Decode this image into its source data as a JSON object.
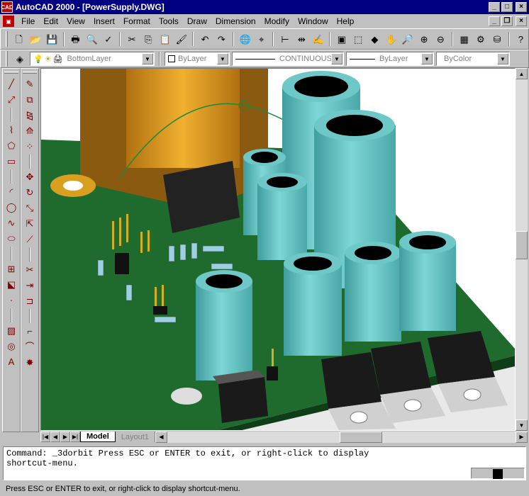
{
  "window": {
    "title": "AutoCAD 2000 - [PowerSupply.DWG]",
    "app_icon_text": "CAD",
    "minimize": "_",
    "maximize": "□",
    "close": "×"
  },
  "menu": {
    "items": [
      "File",
      "Edit",
      "View",
      "Insert",
      "Format",
      "Tools",
      "Draw",
      "Dimension",
      "Modify",
      "Window",
      "Help"
    ],
    "doc_minimize": "_",
    "doc_restore": "❐",
    "doc_close": "×"
  },
  "standard_toolbar": {
    "icons": [
      {
        "name": "new-icon",
        "glyph": "🗋"
      },
      {
        "name": "open-icon",
        "glyph": "📂"
      },
      {
        "name": "save-icon",
        "glyph": "💾"
      },
      {
        "name": "print-icon",
        "glyph": "🖶"
      },
      {
        "name": "print-preview-icon",
        "glyph": "🔍"
      },
      {
        "name": "spelling-icon",
        "glyph": "✓"
      },
      {
        "name": "cut-icon",
        "glyph": "✂"
      },
      {
        "name": "copy-icon",
        "glyph": "⎘"
      },
      {
        "name": "paste-icon",
        "glyph": "📋"
      },
      {
        "name": "match-properties-icon",
        "glyph": "🖌"
      },
      {
        "name": "undo-icon",
        "glyph": "↶"
      },
      {
        "name": "redo-icon",
        "glyph": "↷"
      },
      {
        "name": "hyperlink-icon",
        "glyph": "🌐"
      },
      {
        "name": "object-snap-icon",
        "glyph": "⌖"
      },
      {
        "name": "ucs-icon",
        "glyph": "⊢"
      },
      {
        "name": "inquiry-icon",
        "glyph": "⇹"
      },
      {
        "name": "redraw-icon",
        "glyph": "✍"
      },
      {
        "name": "named-views-icon",
        "glyph": "▣"
      },
      {
        "name": "3d-views-icon",
        "glyph": "⬚"
      },
      {
        "name": "shade-icon",
        "glyph": "◆"
      },
      {
        "name": "pan-icon",
        "glyph": "✋"
      },
      {
        "name": "zoom-realtime-icon",
        "glyph": "🔎"
      },
      {
        "name": "zoom-window-icon",
        "glyph": "⊕"
      },
      {
        "name": "zoom-previous-icon",
        "glyph": "⊖"
      },
      {
        "name": "properties-icon",
        "glyph": "▦"
      },
      {
        "name": "design-center-icon",
        "glyph": "⚙"
      },
      {
        "name": "dbconnect-icon",
        "glyph": "⛁"
      },
      {
        "name": "help-icon",
        "glyph": "?"
      }
    ]
  },
  "properties_toolbar": {
    "layer_icons": [
      "◈",
      "💡",
      "☀",
      "🖨"
    ],
    "layer": "BottomLayer",
    "color": "ByLayer",
    "linetype": "CONTINUOUS",
    "lineweight": "ByLayer",
    "plotstyle": "ByColor"
  },
  "draw_toolbar": {
    "icons": [
      {
        "name": "line-icon",
        "glyph": "╱"
      },
      {
        "name": "construction-line-icon",
        "glyph": "⤢"
      },
      {
        "name": "polyline-icon",
        "glyph": "⌇"
      },
      {
        "name": "polygon-icon",
        "glyph": "⬠"
      },
      {
        "name": "rectangle-icon",
        "glyph": "▭"
      },
      {
        "name": "arc-icon",
        "glyph": "◜"
      },
      {
        "name": "circle-icon",
        "glyph": "◯"
      },
      {
        "name": "spline-icon",
        "glyph": "∿"
      },
      {
        "name": "ellipse-icon",
        "glyph": "⬭"
      },
      {
        "name": "insert-block-icon",
        "glyph": "⊞"
      },
      {
        "name": "make-block-icon",
        "glyph": "⬕"
      },
      {
        "name": "point-icon",
        "glyph": "·"
      },
      {
        "name": "hatch-icon",
        "glyph": "▨"
      },
      {
        "name": "region-icon",
        "glyph": "◎"
      },
      {
        "name": "multiline-text-icon",
        "glyph": "A"
      }
    ]
  },
  "modify_toolbar": {
    "icons": [
      {
        "name": "erase-icon",
        "glyph": "✎"
      },
      {
        "name": "copy-object-icon",
        "glyph": "⧉"
      },
      {
        "name": "mirror-icon",
        "glyph": "⧎"
      },
      {
        "name": "offset-icon",
        "glyph": "⟰"
      },
      {
        "name": "array-icon",
        "glyph": "⁘"
      },
      {
        "name": "move-icon",
        "glyph": "✥"
      },
      {
        "name": "rotate-icon",
        "glyph": "↻"
      },
      {
        "name": "scale-icon",
        "glyph": "⤡"
      },
      {
        "name": "stretch-icon",
        "glyph": "⇱"
      },
      {
        "name": "lengthen-icon",
        "glyph": "⟋"
      },
      {
        "name": "trim-icon",
        "glyph": "✂"
      },
      {
        "name": "extend-icon",
        "glyph": "⇥"
      },
      {
        "name": "break-icon",
        "glyph": "⊐"
      },
      {
        "name": "chamfer-icon",
        "glyph": "⌐"
      },
      {
        "name": "fillet-icon",
        "glyph": "⌒"
      },
      {
        "name": "explode-icon",
        "glyph": "✸"
      }
    ]
  },
  "tabs": {
    "nav": [
      "|◀",
      "◀",
      "▶",
      "▶|"
    ],
    "items": [
      "Model",
      "Layout1"
    ],
    "active": "Model"
  },
  "command_window": {
    "line1": "Command: _3dorbit Press ESC or ENTER to exit, or right-click to display",
    "line2": "shortcut-menu."
  },
  "status_bar": {
    "text": "Press ESC or ENTER to exit, or right-click to display shortcut-menu."
  },
  "colors": {
    "title_bar": "#000080",
    "pcb_green": "#1f6b2e",
    "capacitor": "#6fc8c8",
    "transformer": "#e0a020",
    "orbit_arc": "#1a8a3a"
  }
}
